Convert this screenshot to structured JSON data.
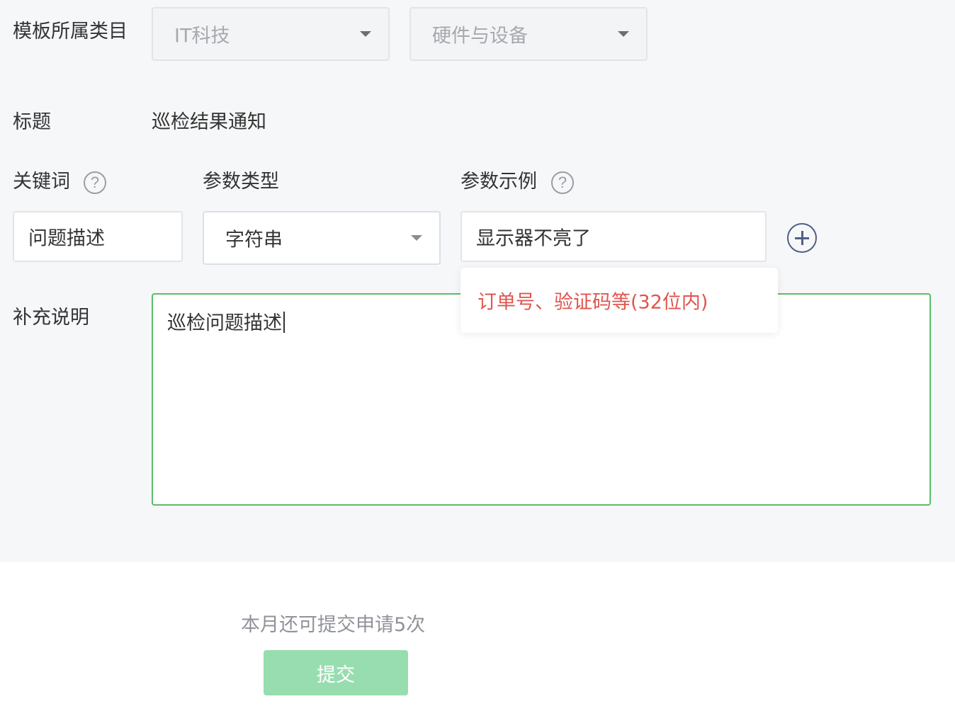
{
  "category": {
    "label": "模板所属类目",
    "primary": "IT科技",
    "secondary": "硬件与设备"
  },
  "title": {
    "label": "标题",
    "value": "巡检结果通知"
  },
  "param_headers": {
    "keyword": "关键词",
    "type": "参数类型",
    "example": "参数示例",
    "help_glyph": "?"
  },
  "param_row": {
    "keyword": "问题描述",
    "type": "字符串",
    "example": "显示器不亮了"
  },
  "tooltip": {
    "text": "订单号、验证码等(32位内)",
    "color": "#e0554e"
  },
  "note": {
    "label": "补充说明",
    "value": "巡检问题描述"
  },
  "footer": {
    "quota_text": "本月还可提交申请5次",
    "submit_label": "提交"
  },
  "colors": {
    "accent_green": "#5bbd6a",
    "submit_disabled": "#98ddb0",
    "add_icon": "#4f5f86"
  },
  "icons": {
    "add": "plus-circle-icon",
    "help": "question-circle-icon",
    "dropdown": "caret-down-icon"
  }
}
